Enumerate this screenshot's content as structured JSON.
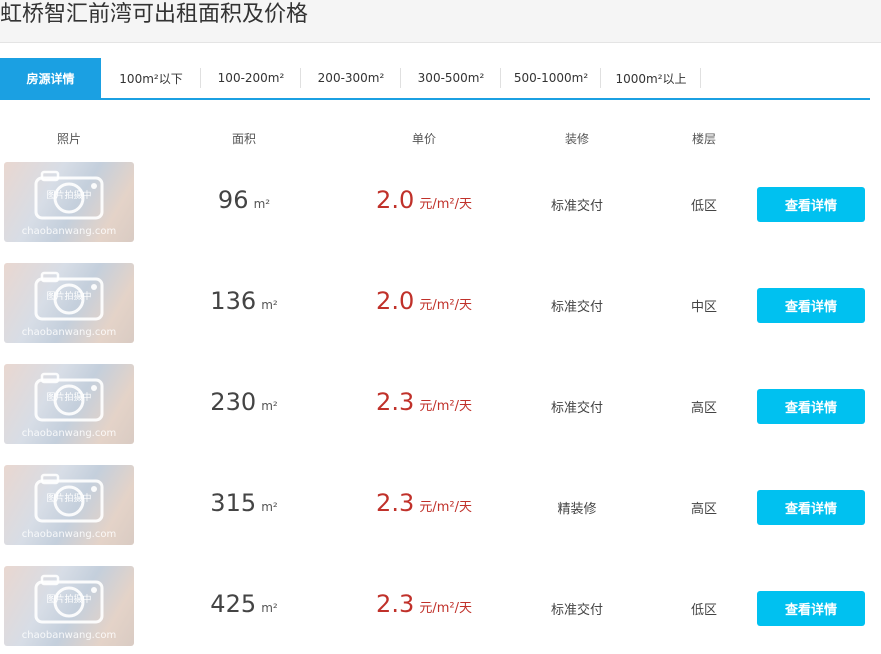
{
  "page": {
    "title": "虹桥智汇前湾可出租面积及价格"
  },
  "tabs": [
    {
      "label": "房源详情",
      "active": true
    },
    {
      "label": "100m²以下"
    },
    {
      "label": "100-200m²"
    },
    {
      "label": "200-300m²"
    },
    {
      "label": "300-500m²"
    },
    {
      "label": "500-1000m²"
    },
    {
      "label": "1000m²以上"
    }
  ],
  "columns": {
    "photo": "照片",
    "area": "面积",
    "price": "单价",
    "decoration": "装修",
    "floor": "楼层"
  },
  "photo": {
    "caption": "图片拍摄中",
    "watermark": "chaobanwang.com"
  },
  "units": {
    "area": "m²",
    "price": "元/m²/天"
  },
  "listings": [
    {
      "area": "96",
      "price": "2.0",
      "decoration": "标准交付",
      "floor": "低区",
      "button": "查看详情"
    },
    {
      "area": "136",
      "price": "2.0",
      "decoration": "标准交付",
      "floor": "中区",
      "button": "查看详情"
    },
    {
      "area": "230",
      "price": "2.3",
      "decoration": "标准交付",
      "floor": "高区",
      "button": "查看详情"
    },
    {
      "area": "315",
      "price": "2.3",
      "decoration": "精装修",
      "floor": "高区",
      "button": "查看详情"
    },
    {
      "area": "425",
      "price": "2.3",
      "decoration": "标准交付",
      "floor": "低区",
      "button": "查看详情"
    }
  ],
  "colors": {
    "accent": "#1ba0e2",
    "button": "#00c1f0",
    "price": "#c0312a"
  }
}
